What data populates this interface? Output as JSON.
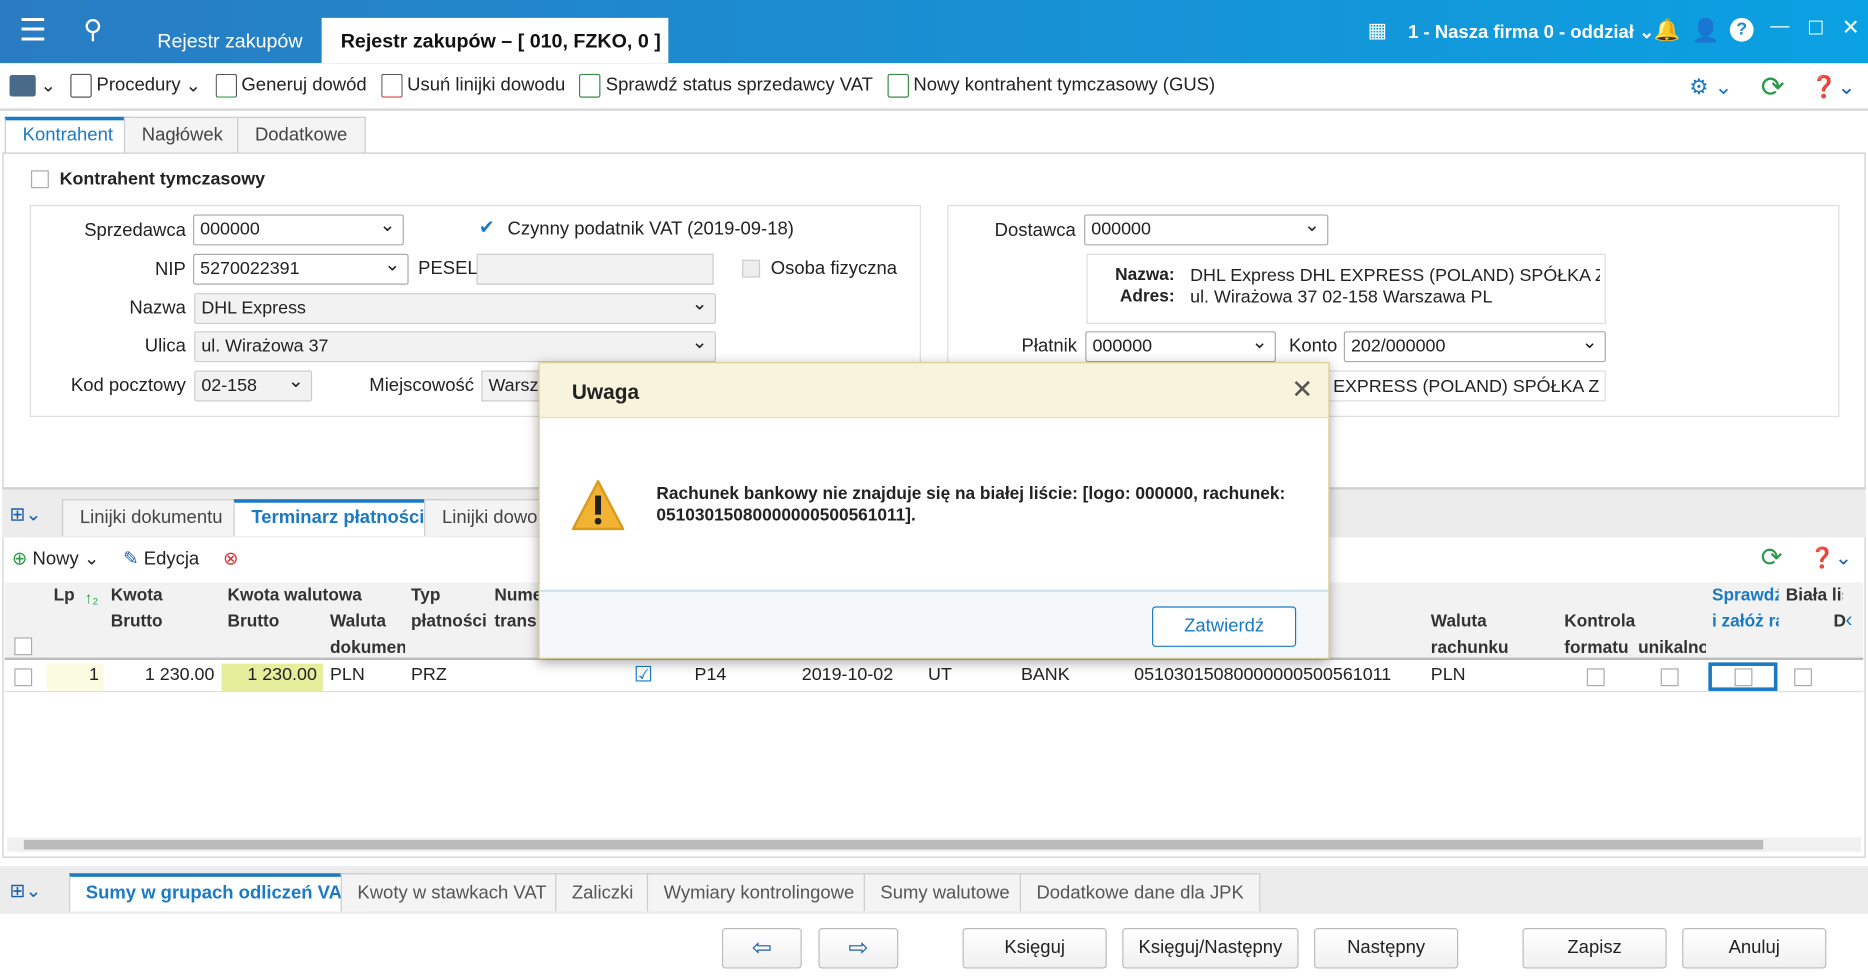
{
  "window": {
    "tabs": [
      "Rejestr zakupów",
      "Rejestr zakupów – [ 010, FZKO, 0 ]"
    ],
    "company": "1 - Nasza firma 0 - oddział"
  },
  "toolbar": {
    "procedures": "Procedury",
    "generate": "Generuj dowód",
    "remove_lines": "Usuń linijki dowodu",
    "check_vat": "Sprawdź status sprzedawcy VAT",
    "new_contractor": "Nowy kontrahent tymczasowy (GUS)"
  },
  "tabs": [
    "Kontrahent",
    "Nagłówek",
    "Dodatkowe"
  ],
  "form": {
    "temp_contractor": "Kontrahent tymczasowy",
    "seller_label": "Sprzedawca",
    "seller": "000000",
    "vat_active": "Czynny podatnik VAT (2019-09-18)",
    "nip_label": "NIP",
    "nip": "5270022391",
    "pesel_label": "PESEL",
    "pesel": "",
    "natural_person": "Osoba fizyczna",
    "name_label": "Nazwa",
    "name": "DHL Express",
    "street_label": "Ulica",
    "street": "ul. Wirażowa 37",
    "postal_label": "Kod pocztowy",
    "postal": "02-158",
    "city_label": "Miejscowość",
    "city": "Warsz",
    "supplier_label": "Dostawca",
    "supplier": "000000",
    "sup_name_label": "Nazwa:",
    "sup_name": "DHL Express DHL EXPRESS (POLAND) SPÓŁKA Z O",
    "sup_addr_label": "Adres:",
    "sup_addr": "ul. Wirażowa 37 02-158 Warszawa PL",
    "payer_label": "Płatnik",
    "payer": "000000",
    "account_label": "Konto",
    "account": "202/000000",
    "payer_name": "EXPRESS (POLAND) SPÓŁKA Z O"
  },
  "grid_tabs": [
    "Linijki dokumentu",
    "Terminarz płatności",
    "Linijki dowo"
  ],
  "grid_toolbar": {
    "new": "Nowy",
    "edit": "Edycja"
  },
  "grid": {
    "headers": {
      "lp": "Lp",
      "kwota": "Kwota",
      "brutto": "Brutto",
      "kw_wal": "Kwota walutowa",
      "brutto2": "Brutto",
      "waluta": "Waluta",
      "dokument": "dokument",
      "typ": "Typ",
      "platnosci": "płatności",
      "nume": "Nume",
      "trans": "trans",
      "waluta_r": "Waluta",
      "rachunku": "rachunku",
      "kontrola": "Kontrola",
      "formatu": "formatu",
      "unikal": "unikalno",
      "sprawdz": "Sprawdź",
      "zaloz": "i załóż ra",
      "biala": "Biała lis",
      "d": "D"
    },
    "rows": [
      {
        "lp": "1",
        "brutto": "1 230.00",
        "brutto_wal": "1 230.00",
        "waluta": "PLN",
        "typ": "PRZ",
        "kod": "P14",
        "data": "2019-10-02",
        "ut": "UT",
        "bank": "BANK",
        "rachunek": "05103015080000000500561011",
        "waluta_r": "PLN"
      }
    ]
  },
  "bottom_tabs": [
    "Sumy w grupach odliczeń VAT",
    "Kwoty w stawkach VAT",
    "Zaliczki",
    "Wymiary kontrolingowe",
    "Sumy walutowe",
    "Dodatkowe dane dla JPK"
  ],
  "buttons": {
    "book": "Księguj",
    "book_next": "Księguj/Następny",
    "next": "Następny",
    "save": "Zapisz",
    "cancel": "Anuluj"
  },
  "dialog": {
    "title": "Uwaga",
    "message": "Rachunek bankowy nie znajduje się na białej liście: [logo: 000000, rachunek: 05103015080000000500561011].",
    "confirm": "Zatwierdź"
  },
  "colors": {
    "accent": "#1a7ac4",
    "dialog_header": "#f7f3dc",
    "highlight": "#e6ee9c"
  }
}
